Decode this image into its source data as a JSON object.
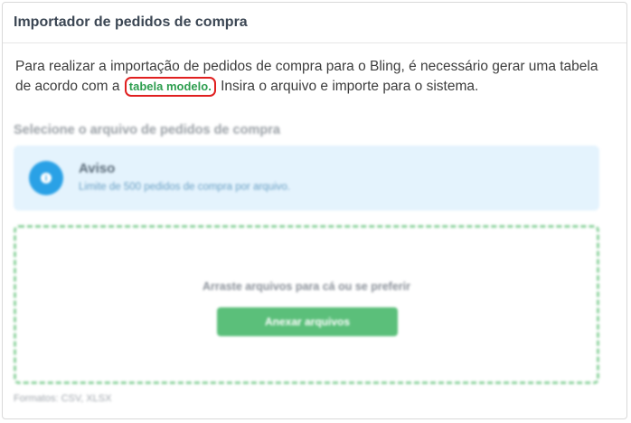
{
  "header": {
    "title": "Importador de pedidos de compra"
  },
  "intro": {
    "text_before": "Para realizar a importação de pedidos de compra para o Bling, é necessário gerar uma tabela de acordo com a",
    "link_label": "tabela modelo.",
    "text_after": "Insira o arquivo e importe para o sistema."
  },
  "upload_section": {
    "label": "Selecione o arquivo de pedidos de compra"
  },
  "notice": {
    "icon": "info-icon",
    "title": "Aviso",
    "text": "Limite de 500 pedidos de compra por arquivo."
  },
  "dropzone": {
    "text": "Arraste arquivos para cá ou se preferir",
    "button_label": "Anexar arquivos"
  },
  "formats": {
    "text": "Formatos: CSV, XLSX"
  },
  "colors": {
    "link": "#2e9e4f",
    "highlight_outline": "#e02020",
    "notice_bg": "#e4f3fd",
    "notice_icon": "#2aa1e6",
    "dropzone_border": "#8fd39f",
    "button_bg": "#5bbf7a"
  }
}
